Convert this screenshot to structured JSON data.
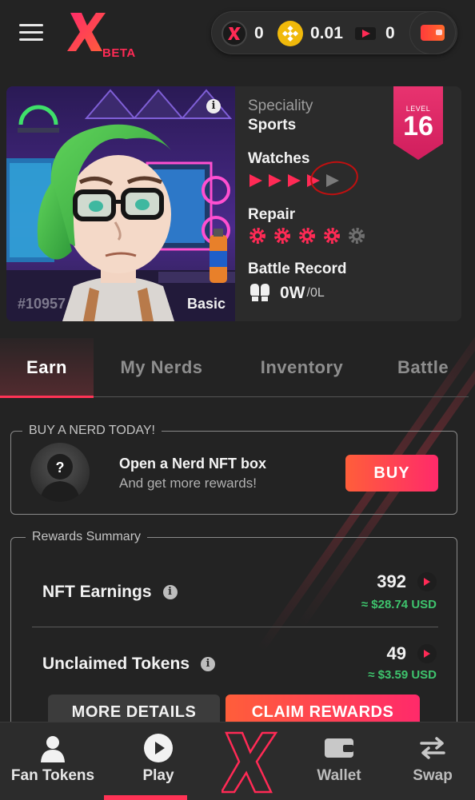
{
  "header": {
    "logo_badge": "BETA",
    "balances": [
      {
        "icon": "x-token-icon",
        "value": "0"
      },
      {
        "icon": "bnb-icon",
        "value": "0.01"
      },
      {
        "icon": "play-token-icon",
        "value": "0"
      }
    ]
  },
  "nerd": {
    "id": "#10957",
    "tier": "Basic",
    "speciality_label": "Speciality",
    "speciality_value": "Sports",
    "level_label": "LEVEL",
    "level_value": "16",
    "watches_label": "Watches",
    "watches_filled": 4,
    "watches_total": 5,
    "repair_label": "Repair",
    "repair_filled": 4,
    "repair_total": 5,
    "battle_label": "Battle Record",
    "battle_wins": "0W",
    "battle_losses": "/0L"
  },
  "tabs": [
    {
      "label": "Earn",
      "active": true
    },
    {
      "label": "My Nerds",
      "active": false
    },
    {
      "label": "Inventory",
      "active": false
    },
    {
      "label": "Battle",
      "active": false
    }
  ],
  "buy_box": {
    "legend": "BUY A NERD TODAY!",
    "title": "Open a Nerd NFT box",
    "subtitle": "And get more rewards!",
    "button": "BUY"
  },
  "rewards": {
    "legend": "Rewards Summary",
    "rows": [
      {
        "label": "NFT Earnings",
        "amount": "392",
        "usd": "≈ $28.74 USD"
      },
      {
        "label": "Unclaimed Tokens",
        "amount": "49",
        "usd": "≈ $3.59 USD"
      }
    ],
    "more_button": "MORE DETAILS",
    "claim_button": "CLAIM REWARDS"
  },
  "bottom_nav": [
    {
      "label": "Fan Tokens",
      "icon": "user-icon"
    },
    {
      "label": "Play",
      "icon": "play-circle-icon",
      "active": true
    },
    {
      "label": "",
      "icon": "x-logo-icon"
    },
    {
      "label": "Wallet",
      "icon": "wallet-icon"
    },
    {
      "label": "Swap",
      "icon": "swap-icon"
    }
  ],
  "colors": {
    "accent": "#ff3355",
    "brand_gradient_start": "#ff5e3a",
    "brand_gradient_end": "#ff2a6a",
    "positive": "#3ec46d",
    "background": "#232323"
  }
}
